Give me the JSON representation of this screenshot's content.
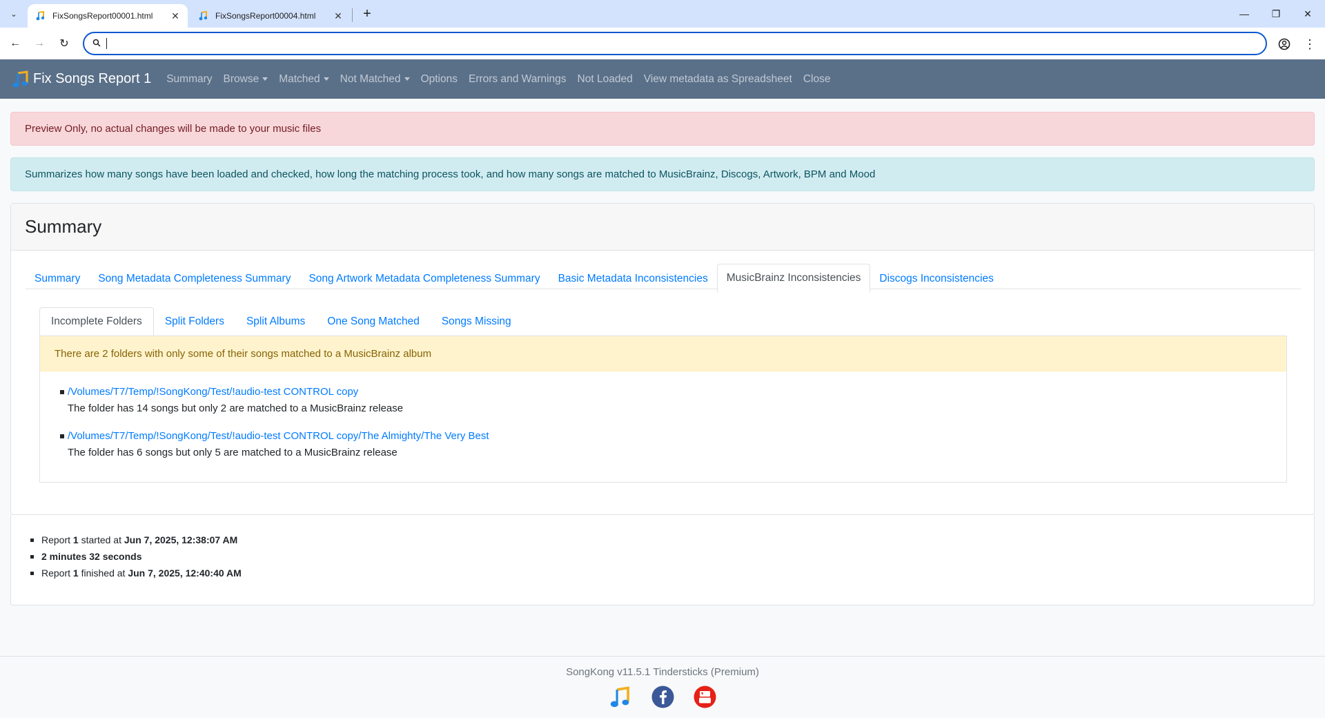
{
  "browser": {
    "tabs": [
      {
        "title": "FixSongsReport00001.html"
      },
      {
        "title": "FixSongsReport00004.html"
      }
    ],
    "address": ""
  },
  "navbar": {
    "brand": "Fix Songs Report 1",
    "links": [
      "Summary",
      "Browse",
      "Matched",
      "Not Matched",
      "Options",
      "Errors and Warnings",
      "Not Loaded",
      "View metadata as Spreadsheet",
      "Close"
    ]
  },
  "alerts": {
    "preview": "Preview Only, no actual changes will be made to your music files",
    "info": "Summarizes how many songs have been loaded and checked, how long the matching process took, and how many songs are matched to MusicBrainz, Discogs, Artwork, BPM and Mood"
  },
  "card": {
    "title": "Summary",
    "tabs": [
      "Summary",
      "Song Metadata Completeness Summary",
      "Song Artwork Metadata Completeness Summary",
      "Basic Metadata Inconsistencies",
      "MusicBrainz Inconsistencies",
      "Discogs Inconsistencies"
    ],
    "subtabs": [
      "Incomplete Folders",
      "Split Folders",
      "Split Albums",
      "One Song Matched",
      "Songs Missing"
    ],
    "warning": "There are 2 folders with only some of their songs matched to a MusicBrainz album",
    "folders": [
      {
        "path": "/Volumes/T7/Temp/!SongKong/Test/!audio-test CONTROL copy",
        "desc": "The folder has 14 songs but only 2 are matched to a MusicBrainz release"
      },
      {
        "path": "/Volumes/T7/Temp/!SongKong/Test/!audio-test CONTROL copy/The Almighty/The Very Best",
        "desc": "The folder has 6 songs but only 5 are matched to a MusicBrainz release"
      }
    ]
  },
  "timing": {
    "report_word": "Report",
    "report_num": "1",
    "started_label": "started at",
    "started_at": "Jun 7, 2025, 12:38:07 AM",
    "duration": "2 minutes 32 seconds",
    "finished_label": "finished at",
    "finished_at": "Jun 7, 2025, 12:40:40 AM"
  },
  "footer": {
    "text": "SongKong v11.5.1 Tindersticks (Premium)"
  },
  "colors": {
    "navbar": "#5a7089",
    "link": "#007bff",
    "facebook": "#3b5998",
    "youtube": "#e62117"
  }
}
